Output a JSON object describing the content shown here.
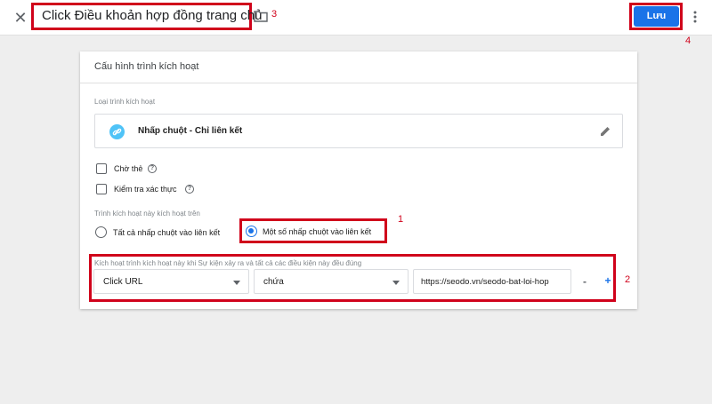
{
  "header": {
    "title": "Click Điều khoản hợp đồng trang chủ",
    "save_label": "Lưu",
    "annotations": {
      "title": "3",
      "save": "4"
    }
  },
  "card": {
    "title": "Cấu hình trình kích hoạt",
    "trigger_type_label": "Loại trình kích hoạt",
    "trigger_type": "Nhấp chuột - Chỉ liên kết",
    "checkboxes": [
      {
        "label": "Chờ thẻ",
        "checked": false
      },
      {
        "label": "Kiểm tra xác thực",
        "checked": false
      }
    ],
    "fire_on_label": "Trình kích hoạt này kích hoạt trên",
    "fire_options": [
      {
        "label": "Tất cả nhấp chuột vào liên kết",
        "selected": false
      },
      {
        "label": "Một số nhấp chuột vào liên kết",
        "selected": true
      }
    ],
    "condition_label": "Kích hoạt trình kích hoạt này khi Sự kiện xảy ra và tất cả các điều kiện này đều đúng",
    "condition": {
      "variable": "Click URL",
      "operator": "chứa",
      "value": "https://seodo.vn/seodo-bat-loi-hop",
      "remove": "-",
      "add": "+"
    },
    "annotations": {
      "fire_on": "1",
      "condition": "2"
    }
  },
  "colors": {
    "accent": "#1a73e8",
    "annotation": "#d0021b",
    "link_icon": "#4fc3f7"
  },
  "icons": [
    "close-icon",
    "folder-icon",
    "more-vert-icon",
    "link-icon",
    "edit-pencil-icon",
    "help-icon",
    "caret-down-icon"
  ]
}
